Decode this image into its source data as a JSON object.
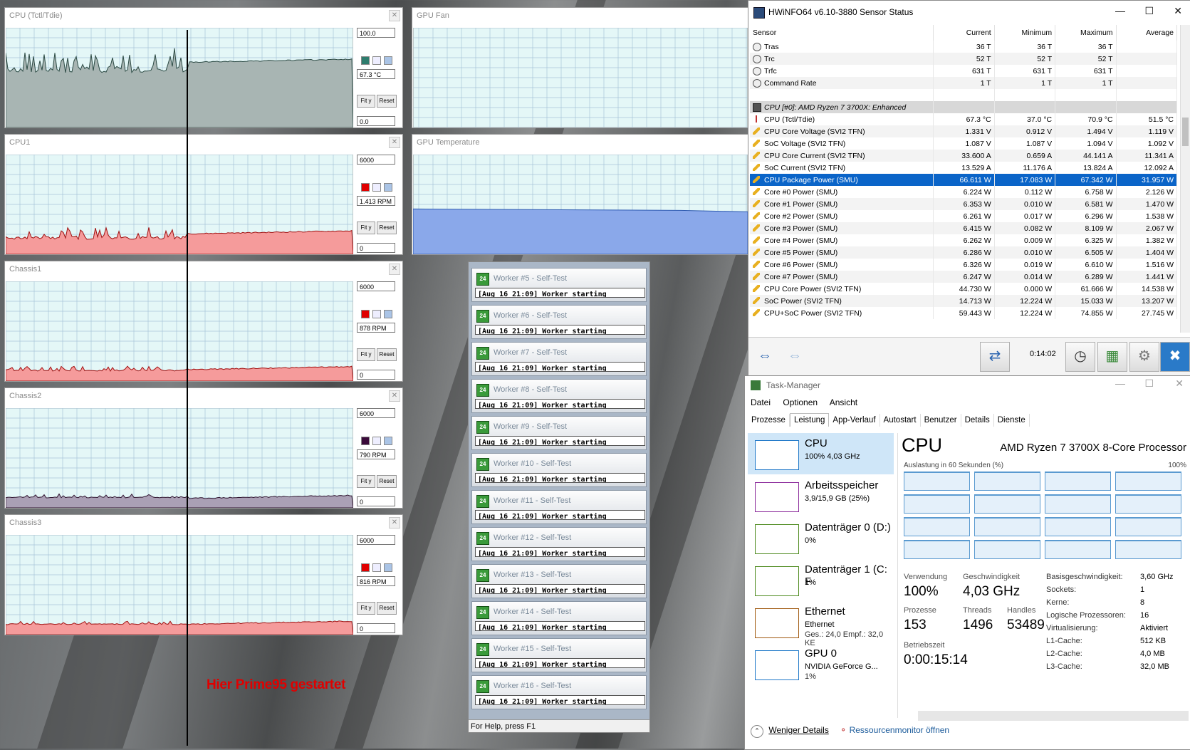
{
  "graphs": [
    {
      "title": "CPU (Tctl/Tdie)",
      "max": "100.0",
      "current": "67.3 °C",
      "min": "0.0",
      "swatch": "#2e7d6e",
      "fill": "#a8b5b3",
      "stroke": "#2c4a44",
      "level": 0.67,
      "pre_level": 0.55,
      "spikes": 0.25
    },
    {
      "title": "CPU1",
      "max": "6000",
      "current": "1.413 RPM",
      "min": "0",
      "swatch": "#e00000",
      "fill": "#f59b9b",
      "stroke": "#a01010",
      "level": 0.22,
      "pre_level": 0.15,
      "spikes": 0.12
    },
    {
      "title": "Chassis1",
      "max": "6000",
      "current": "878 RPM",
      "min": "0",
      "swatch": "#e00000",
      "fill": "#f59b9b",
      "stroke": "#a01010",
      "level": 0.13,
      "pre_level": 0.1,
      "spikes": 0.05
    },
    {
      "title": "Chassis2",
      "max": "6000",
      "current": "790 RPM",
      "min": "0",
      "swatch": "#3a0a3a",
      "fill": "#aaa0b5",
      "stroke": "#301530",
      "level": 0.11,
      "pre_level": 0.1,
      "spikes": 0.04
    },
    {
      "title": "Chassis3",
      "max": "6000",
      "current": "816 RPM",
      "min": "0",
      "swatch": "#e00000",
      "fill": "#f59b9b",
      "stroke": "#a01010",
      "level": 0.12,
      "pre_level": 0.1,
      "spikes": 0.04
    }
  ],
  "gpu_graphs": [
    {
      "title": "GPU Fan",
      "level": 0.0
    },
    {
      "title": "GPU Temperature",
      "level": 0.44
    }
  ],
  "buttons": {
    "fit": "Fit y",
    "reset": "Reset"
  },
  "annotation": "Hier Prime95 gestartet",
  "prime95": {
    "workers": [
      "Worker #5 - Self-Test",
      "Worker #6 - Self-Test",
      "Worker #7 - Self-Test",
      "Worker #8 - Self-Test",
      "Worker #9 - Self-Test",
      "Worker #10 - Self-Test",
      "Worker #11 - Self-Test",
      "Worker #12 - Self-Test",
      "Worker #13 - Self-Test",
      "Worker #14 - Self-Test",
      "Worker #15 - Self-Test",
      "Worker #16 - Self-Test"
    ],
    "log": "[Aug 16 21:09] Worker starting",
    "status": "For Help, press F1"
  },
  "hwinfo": {
    "title": "HWiNFO64 v6.10-3880 Sensor Status",
    "columns": [
      "Sensor",
      "Current",
      "Minimum",
      "Maximum",
      "Average"
    ],
    "rows": [
      {
        "name": "Tras",
        "cur": "36 T",
        "min": "36 T",
        "max": "36 T",
        "avg": "",
        "icon": "timing"
      },
      {
        "name": "Trc",
        "cur": "52 T",
        "min": "52 T",
        "max": "52 T",
        "avg": "",
        "icon": "timing"
      },
      {
        "name": "Trfc",
        "cur": "631 T",
        "min": "631 T",
        "max": "631 T",
        "avg": "",
        "icon": "timing"
      },
      {
        "name": "Command Rate",
        "cur": "1 T",
        "min": "1 T",
        "max": "1 T",
        "avg": "",
        "icon": "timing"
      },
      {
        "name": "",
        "cur": "",
        "min": "",
        "max": "",
        "avg": "",
        "icon": "none"
      },
      {
        "name": "CPU [#0]: AMD Ryzen 7 3700X: Enhanced",
        "cur": "",
        "min": "",
        "max": "",
        "avg": "",
        "icon": "chip",
        "group": true
      },
      {
        "name": "CPU (Tctl/Tdie)",
        "cur": "67.3 °C",
        "min": "37.0 °C",
        "max": "70.9 °C",
        "avg": "51.5 °C",
        "icon": "thermo"
      },
      {
        "name": "CPU Core Voltage (SVI2 TFN)",
        "cur": "1.331 V",
        "min": "0.912 V",
        "max": "1.494 V",
        "avg": "1.119 V",
        "icon": "bolt"
      },
      {
        "name": "SoC Voltage (SVI2 TFN)",
        "cur": "1.087 V",
        "min": "1.087 V",
        "max": "1.094 V",
        "avg": "1.092 V",
        "icon": "bolt"
      },
      {
        "name": "CPU Core Current (SVI2 TFN)",
        "cur": "33.600 A",
        "min": "0.659 A",
        "max": "44.141 A",
        "avg": "11.341 A",
        "icon": "bolt"
      },
      {
        "name": "SoC Current (SVI2 TFN)",
        "cur": "13.529 A",
        "min": "11.176 A",
        "max": "13.824 A",
        "avg": "12.092 A",
        "icon": "bolt"
      },
      {
        "name": "CPU Package Power (SMU)",
        "cur": "66.611 W",
        "min": "17.083 W",
        "max": "67.342 W",
        "avg": "31.957 W",
        "icon": "bolt",
        "selected": true
      },
      {
        "name": "Core #0 Power (SMU)",
        "cur": "6.224 W",
        "min": "0.112 W",
        "max": "6.758 W",
        "avg": "2.126 W",
        "icon": "bolt"
      },
      {
        "name": "Core #1 Power (SMU)",
        "cur": "6.353 W",
        "min": "0.010 W",
        "max": "6.581 W",
        "avg": "1.470 W",
        "icon": "bolt"
      },
      {
        "name": "Core #2 Power (SMU)",
        "cur": "6.261 W",
        "min": "0.017 W",
        "max": "6.296 W",
        "avg": "1.538 W",
        "icon": "bolt"
      },
      {
        "name": "Core #3 Power (SMU)",
        "cur": "6.415 W",
        "min": "0.082 W",
        "max": "8.109 W",
        "avg": "2.067 W",
        "icon": "bolt"
      },
      {
        "name": "Core #4 Power (SMU)",
        "cur": "6.262 W",
        "min": "0.009 W",
        "max": "6.325 W",
        "avg": "1.382 W",
        "icon": "bolt"
      },
      {
        "name": "Core #5 Power (SMU)",
        "cur": "6.286 W",
        "min": "0.010 W",
        "max": "6.505 W",
        "avg": "1.404 W",
        "icon": "bolt"
      },
      {
        "name": "Core #6 Power (SMU)",
        "cur": "6.326 W",
        "min": "0.019 W",
        "max": "6.610 W",
        "avg": "1.516 W",
        "icon": "bolt"
      },
      {
        "name": "Core #7 Power (SMU)",
        "cur": "6.247 W",
        "min": "0.014 W",
        "max": "6.289 W",
        "avg": "1.441 W",
        "icon": "bolt"
      },
      {
        "name": "CPU Core Power (SVI2 TFN)",
        "cur": "44.730 W",
        "min": "0.000 W",
        "max": "61.666 W",
        "avg": "14.538 W",
        "icon": "bolt"
      },
      {
        "name": "SoC Power (SVI2 TFN)",
        "cur": "14.713 W",
        "min": "12.224 W",
        "max": "15.033 W",
        "avg": "13.207 W",
        "icon": "bolt"
      },
      {
        "name": "CPU+SoC Power (SVI2 TFN)",
        "cur": "59.443 W",
        "min": "12.224 W",
        "max": "74.855 W",
        "avg": "27.745 W",
        "icon": "bolt"
      }
    ],
    "timer": "0:14:02"
  },
  "taskmgr": {
    "title": "Task-Manager",
    "menu": [
      "Datei",
      "Optionen",
      "Ansicht"
    ],
    "tabs": [
      "Prozesse",
      "Leistung",
      "App-Verlauf",
      "Autostart",
      "Benutzer",
      "Details",
      "Dienste"
    ],
    "active_tab": "Leistung",
    "items": [
      {
        "name": "CPU",
        "v": "100% 4,03 GHz",
        "v2": "",
        "color": "#1f78c8",
        "active": true
      },
      {
        "name": "Arbeitsspeicher",
        "v": "3,9/15,9 GB (25%)",
        "v2": "",
        "color": "#8b2a9b"
      },
      {
        "name": "Datenträger 0 (D:)",
        "v": "0%",
        "v2": "",
        "color": "#4d8a1e"
      },
      {
        "name": "Datenträger 1 (C: F",
        "v": "1%",
        "v2": "",
        "color": "#4d8a1e"
      },
      {
        "name": "Ethernet",
        "v": "Ethernet",
        "v2": "Ges.: 24,0 Empf.: 32,0 KE",
        "color": "#a05a10"
      },
      {
        "name": "GPU 0",
        "v": "NVIDIA GeForce G...",
        "v2": "1%",
        "color": "#1f78c8"
      }
    ],
    "cpu_heading": "CPU",
    "cpu_name": "AMD Ryzen 7 3700X 8-Core Processor",
    "graph_label": "Auslastung in 60 Sekunden (%)",
    "graph_max": "100%",
    "stats": {
      "usage_label": "Verwendung",
      "usage": "100%",
      "speed_label": "Geschwindigkeit",
      "speed": "4,03 GHz",
      "proc_label": "Prozesse",
      "proc": "153",
      "threads_label": "Threads",
      "threads": "1496",
      "handles_label": "Handles",
      "handles": "53489",
      "uptime_label": "Betriebszeit",
      "uptime": "0:00:15:14"
    },
    "kv": [
      {
        "k": "Basisgeschwindigkeit:",
        "v": "3,60 GHz"
      },
      {
        "k": "Sockets:",
        "v": "1"
      },
      {
        "k": "Kerne:",
        "v": "8"
      },
      {
        "k": "Logische Prozessoren:",
        "v": "16"
      },
      {
        "k": "Virtualisierung:",
        "v": "Aktiviert"
      },
      {
        "k": "L1-Cache:",
        "v": "512 KB"
      },
      {
        "k": "L2-Cache:",
        "v": "4,0 MB"
      },
      {
        "k": "L3-Cache:",
        "v": "32,0 MB"
      }
    ],
    "fewer_details": "Weniger Details",
    "resmon": "Ressourcenmonitor öffnen"
  }
}
